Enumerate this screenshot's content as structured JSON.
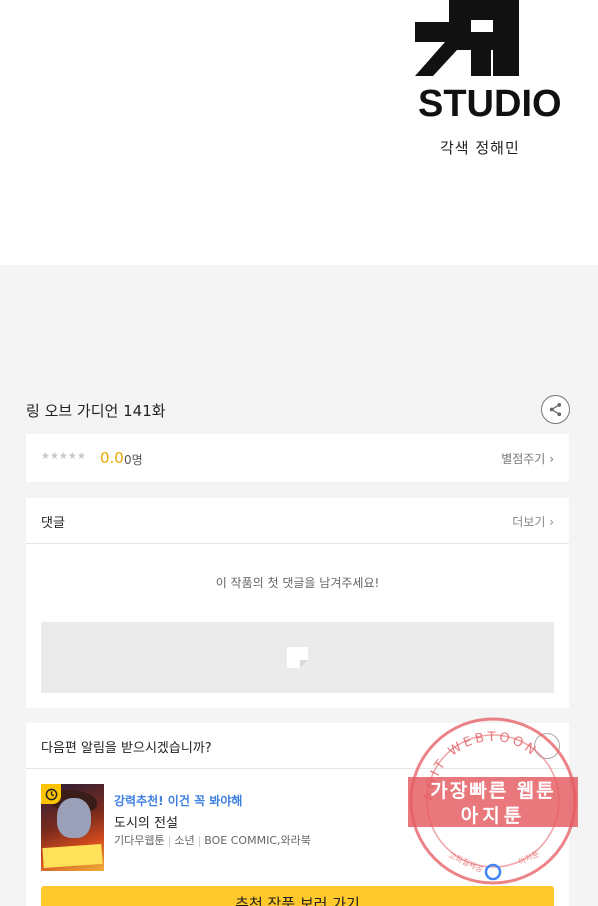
{
  "header_image": {
    "studio_label": "STUDIO",
    "credit": "각색 정해민"
  },
  "episode": {
    "title": "링 오브 가디언 141화"
  },
  "rating": {
    "stars": "★★★★★",
    "score": "0.0",
    "count": "0명",
    "rate_link": "별점주기",
    "link_chevron": "›"
  },
  "comments": {
    "title": "댓글",
    "more_link": "더보기",
    "link_chevron": "›",
    "empty_message": "이 작품의 첫 댓글을 남겨주세요!"
  },
  "notify": {
    "question": "다음편 알림을 받으시겠습니까?"
  },
  "recommendation": {
    "tag": "강력추천! 이건 꼭 봐야해",
    "title": "도시의 전설",
    "meta": [
      "기다무웹툰",
      "소년",
      "BOE COMMIC,와라북"
    ],
    "button_label": "추천 작품 보러 가기"
  },
  "watermark": {
    "ring_text": "AGIT WEBTOON",
    "line1": "가장빠른 웹툰",
    "line2": "아지툰",
    "sub_left": "고화질제공",
    "sub_right": "아지툰"
  },
  "colors": {
    "accent_yellow": "#ffc82b",
    "score_orange": "#e8a800",
    "tag_blue": "#3f7fe0",
    "watermark_red": "#e45a5f"
  },
  "icons": {
    "share": "share-icon",
    "clock": "clock-icon",
    "close": "close-icon",
    "comment_placeholder": "chat-placeholder-icon"
  }
}
